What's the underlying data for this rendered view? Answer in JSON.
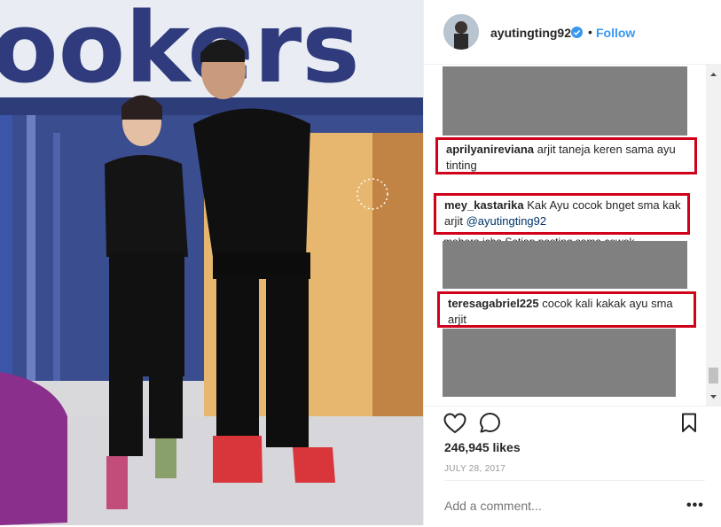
{
  "post": {
    "username": "ayutingting92",
    "separator": "•",
    "follow_label": "Follow",
    "photo_sign_text": "ookers"
  },
  "comments": [
    {
      "user": "aprilyanireviana",
      "text": "arjit taneja keren sama ayu tinting",
      "mention": ""
    },
    {
      "user": "mey_kastarika",
      "text": "Kak Ayu cocok bnget sma kak arjit",
      "mention": "@ayutingting92"
    },
    {
      "user": "teresagabriel225",
      "text": "cocok kali kakak ayu sma arjit",
      "mention": ""
    }
  ],
  "partial_comment": "mahera.icha Setiap posting sama cowok",
  "likes": "246,945 likes",
  "date": "JULY 28, 2017",
  "add_comment_placeholder": "Add a comment...",
  "more_label": "•••",
  "colors": {
    "highlight": "#d0021b",
    "redaction": "#808080",
    "link": "#3897f0"
  },
  "icons": [
    "verified-badge-icon",
    "heart-icon",
    "comment-icon",
    "bookmark-icon",
    "more-options-icon"
  ]
}
